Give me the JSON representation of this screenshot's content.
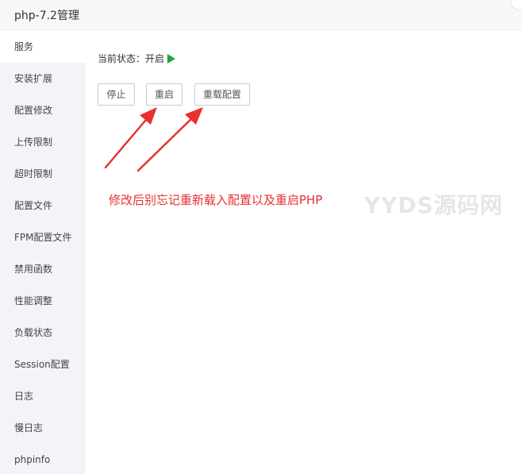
{
  "window": {
    "title": "php-7.2管理"
  },
  "sidebar": {
    "items": [
      {
        "label": "服务",
        "active": true
      },
      {
        "label": "安装扩展"
      },
      {
        "label": "配置修改"
      },
      {
        "label": "上传限制"
      },
      {
        "label": "超时限制"
      },
      {
        "label": "配置文件"
      },
      {
        "label": "FPM配置文件"
      },
      {
        "label": "禁用函数"
      },
      {
        "label": "性能调整"
      },
      {
        "label": "负载状态"
      },
      {
        "label": "Session配置"
      },
      {
        "label": "日志"
      },
      {
        "label": "慢日志"
      },
      {
        "label": "phpinfo"
      }
    ]
  },
  "main": {
    "status_label": "当前状态：开启",
    "status_color": "#20a53a",
    "buttons": {
      "stop": "停止",
      "restart": "重启",
      "reload": "重载配置"
    },
    "annotation": "修改后别忘记重新载入配置以及重启PHP",
    "annotation_color": "#e8302f",
    "watermark": "YYDS源码网"
  },
  "icons": {
    "status": "play-icon",
    "annotation_arrows": "red-arrow-icon"
  }
}
